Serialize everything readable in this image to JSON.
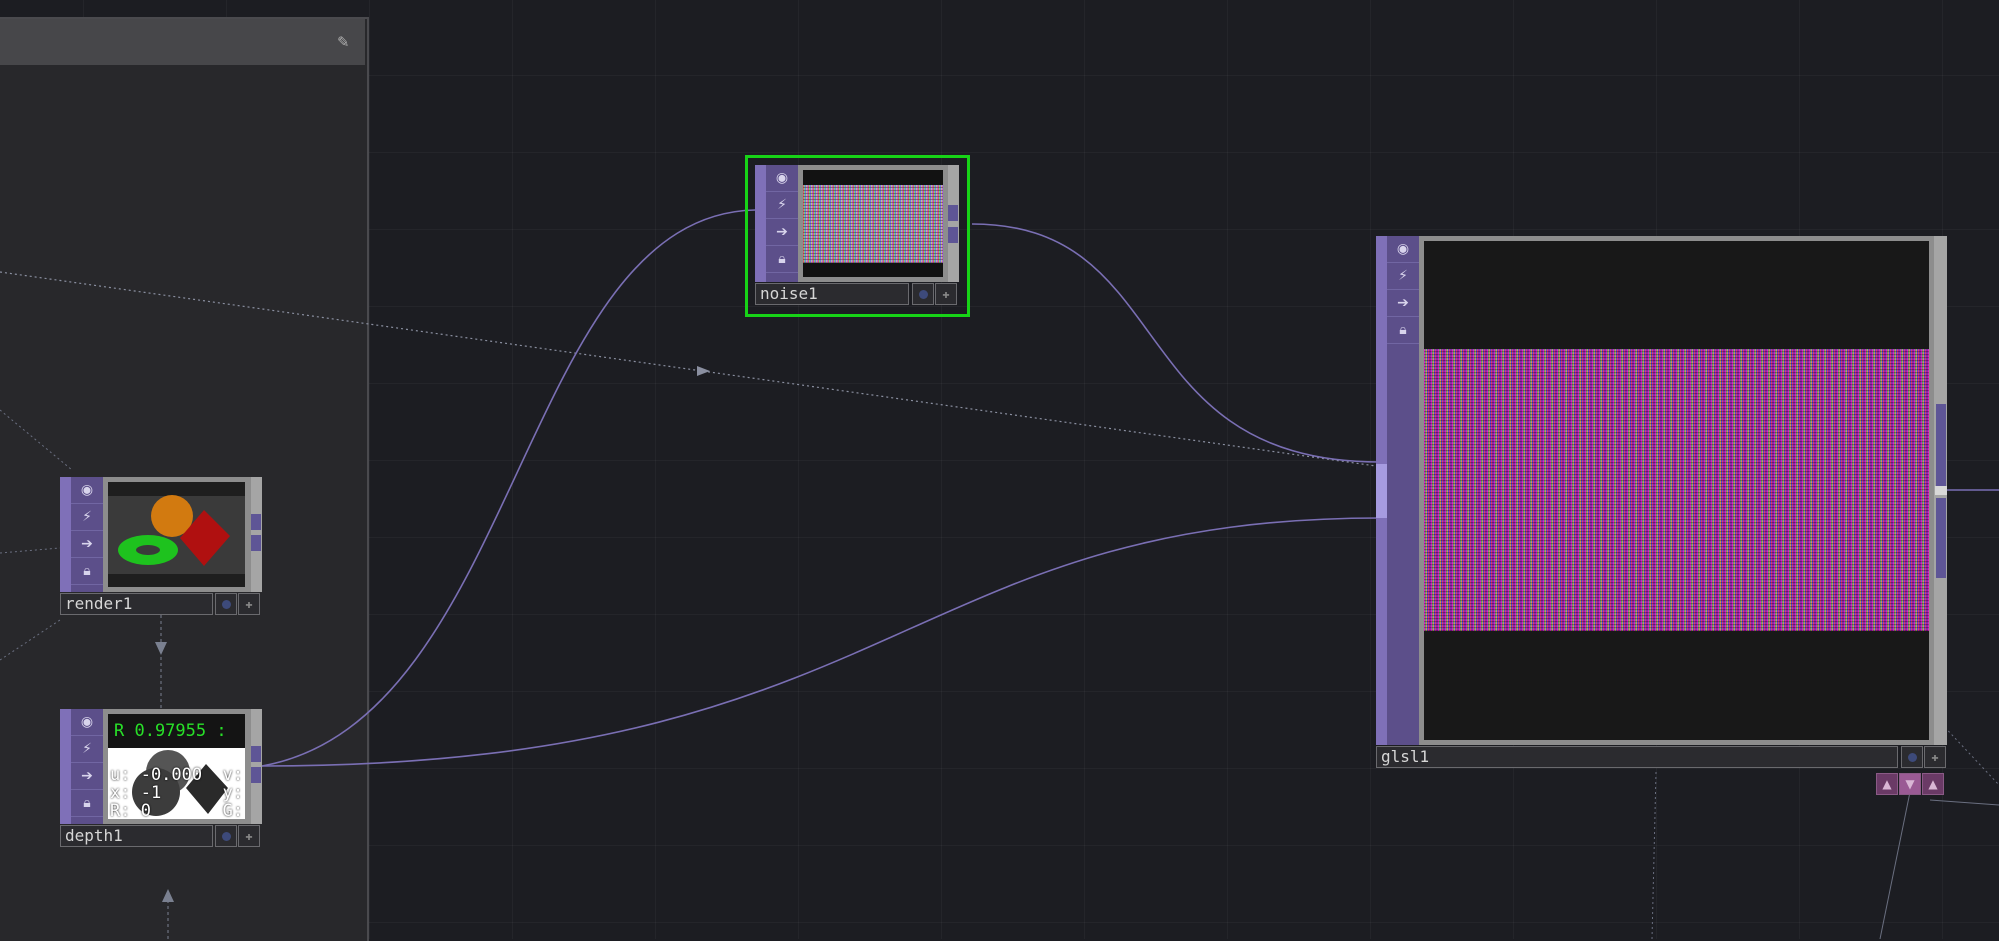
{
  "colors": {
    "background": "#1c1d22",
    "panel": "#28282b",
    "operator_accent": "#7f70b8",
    "selection": "#17d317",
    "wire": "#7a6fb4"
  },
  "panel": {
    "edit_icon": "edit-icon"
  },
  "nodes": {
    "noise1": {
      "label": "noise1",
      "selected": true
    },
    "render1": {
      "label": "render1"
    },
    "depth1": {
      "label": "depth1",
      "readout_line1": "R 0.97955 :",
      "readout_line2": "u: -0.000  v:",
      "readout_line3": "x: -1      y:",
      "readout_line4": "R: 0       G:"
    },
    "glsl1": {
      "label": "glsl1"
    }
  },
  "flag_icons": [
    "viewer-toggle-icon",
    "bypass-icon",
    "display-icon",
    "lock-icon"
  ],
  "glsl_buttons": [
    "cook-up-icon",
    "cook-down-icon",
    "viewer-up-icon"
  ]
}
